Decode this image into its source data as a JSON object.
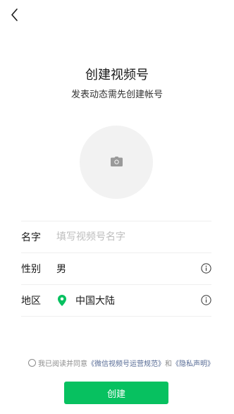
{
  "header": {
    "back_icon": "chevron-left-icon",
    "title": "创建视频号",
    "subtitle": "发表动态需先创建帐号"
  },
  "avatar": {
    "icon": "camera-icon"
  },
  "form": {
    "name": {
      "label": "名字",
      "placeholder": "填写视频号名字",
      "value": ""
    },
    "gender": {
      "label": "性别",
      "value": "男",
      "icon": "info-icon"
    },
    "region": {
      "label": "地区",
      "value": "中国大陆",
      "icon": "location-pin-icon",
      "info_icon": "info-icon"
    }
  },
  "agreement": {
    "prefix": "我已阅读并同意",
    "link1": "《微信视频号运营规范》",
    "and": "和",
    "link2": "《隐私声明》"
  },
  "buttons": {
    "create": "创建"
  },
  "colors": {
    "accent": "#07c160",
    "link": "#576b95",
    "placeholder": "#b8b8b8"
  }
}
